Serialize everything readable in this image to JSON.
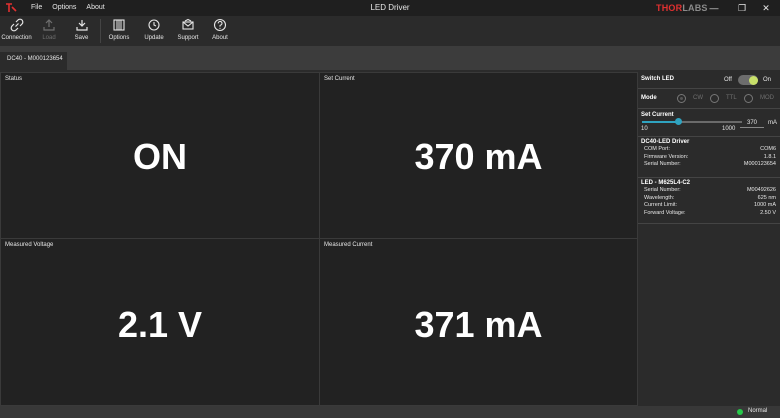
{
  "window": {
    "title": "LED Driver",
    "brand_a": "THOR",
    "brand_b": "LABS",
    "menu": [
      "File",
      "Options",
      "About"
    ],
    "minimize": "—",
    "maximize": "❐",
    "close": "✕"
  },
  "toolbar": {
    "connection": "Connection",
    "load": "Load",
    "save": "Save",
    "options": "Options",
    "update": "Update",
    "support": "Support",
    "about": "About"
  },
  "tabs": [
    "DC40 - M000123654"
  ],
  "panels": {
    "status": {
      "title": "Status",
      "value": "ON"
    },
    "set_current": {
      "title": "Set Current",
      "value": "370 mA"
    },
    "measured_voltage": {
      "title": "Measured Voltage",
      "value": "2.1 V"
    },
    "measured_current": {
      "title": "Measured Current",
      "value": "371 mA"
    }
  },
  "sidebar": {
    "switch_led": {
      "label": "Switch LED",
      "off": "Off",
      "on": "On",
      "state": true
    },
    "mode": {
      "label": "Mode",
      "options": [
        "CW",
        "TTL",
        "MOD"
      ],
      "selected": "CW"
    },
    "set_current": {
      "label": "Set Current",
      "min": "10",
      "max": "1000",
      "value": "370",
      "unit": "mA",
      "min_value": 10,
      "max_value": 1000,
      "current_value": 370
    },
    "driver": {
      "title": "DC40-LED Driver",
      "rows": [
        {
          "label": "COM Port:",
          "value": "COM6"
        },
        {
          "label": "Firmware Version:",
          "value": "1.8.1"
        },
        {
          "label": "Serial Number:",
          "value": "M000123654"
        }
      ]
    },
    "led": {
      "title": "LED - M625L4-C2",
      "rows": [
        {
          "label": "Serial Number:",
          "value": "M00492626"
        },
        {
          "label": "Wavelength:",
          "value": "625 nm"
        },
        {
          "label": "Current Limit:",
          "value": "1000 mA"
        },
        {
          "label": "Forward Voltage:",
          "value": "2.50 V"
        }
      ]
    }
  },
  "statusbar": {
    "text": "Normal",
    "color": "#27c94a"
  },
  "colors": {
    "accent": "#2fa3c0",
    "toggle_on": "#c8e06a",
    "brand_red": "#e23030"
  }
}
